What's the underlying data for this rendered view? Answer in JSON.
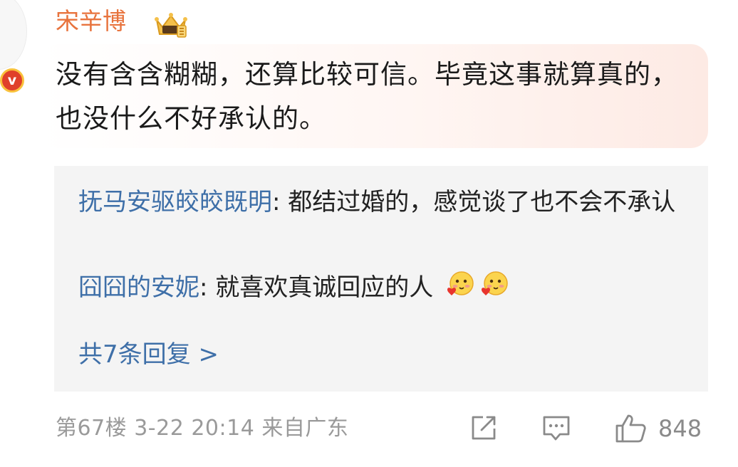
{
  "comment": {
    "username": "宋辛博",
    "badge_letter": "v",
    "text": "没有含含糊糊，还算比较可信。毕竟这事就算真的，也没什么不好承认的。"
  },
  "replies": [
    {
      "author": "抚马安驱皎皎既明",
      "separator": ": ",
      "text": "都结过婚的，感觉谈了也不会不承认"
    },
    {
      "author": "囧囧的安妮",
      "separator": ": ",
      "text": "就喜欢真诚回应的人"
    }
  ],
  "more_replies_label": "共7条回复 >",
  "footer": {
    "meta": "第67楼 3-22 20:14 来自广东",
    "like_count": "848"
  },
  "colors": {
    "username": "#e8733d",
    "link": "#3e6fa8",
    "footer_text": "#9a9a9a"
  }
}
